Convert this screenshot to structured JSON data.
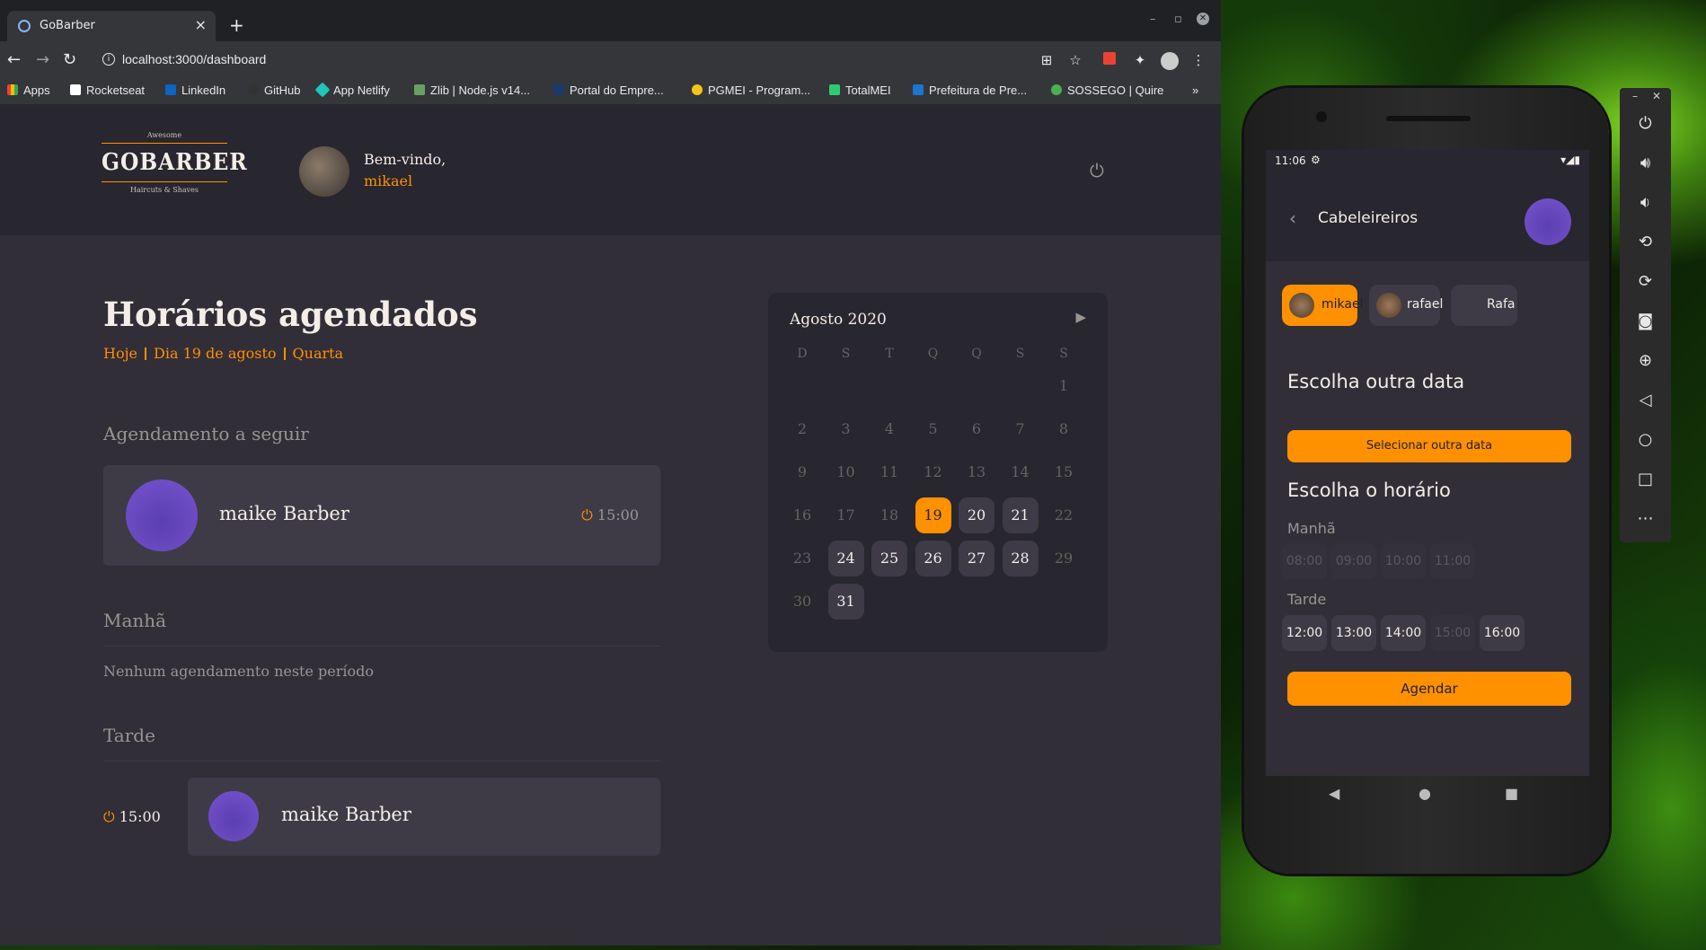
{
  "browser": {
    "tab_title": "GoBarber",
    "url": "localhost:3000/dashboard",
    "bookmarks": [
      "Apps",
      "Rocketseat",
      "LinkedIn",
      "GitHub",
      "App Netlify",
      "Zlib | Node.js v14...",
      "Portal do Empre...",
      "PGMEI - Program...",
      "TotalMEI",
      "Prefeitura de Pre...",
      "SOSSEGO | Quire"
    ],
    "bookmarks_more": "»"
  },
  "app": {
    "logo": {
      "top": "Awesome",
      "name": "GOBARBER",
      "sub": "Haircuts & Shaves"
    },
    "welcome": "Bem-vindo,",
    "username": "mikael",
    "title": "Horários agendados",
    "today": "Hoje",
    "day": "Dia 19 de agosto",
    "weekday": "Quarta",
    "next_label": "Agendamento a seguir",
    "next": {
      "name": "maike Barber",
      "time": "15:00"
    },
    "morning_label": "Manhã",
    "morning_empty": "Nenhum agendamento neste período",
    "afternoon_label": "Tarde",
    "afternoon": [
      {
        "time": "15:00",
        "name": "maike Barber"
      }
    ]
  },
  "calendar": {
    "title": "Agosto 2020",
    "weekdays": [
      "D",
      "S",
      "T",
      "Q",
      "Q",
      "S",
      "S"
    ],
    "days": [
      1,
      2,
      3,
      4,
      5,
      6,
      7,
      8,
      9,
      10,
      11,
      12,
      13,
      14,
      15,
      16,
      17,
      18,
      19,
      20,
      21,
      22,
      23,
      24,
      25,
      26,
      27,
      28,
      29,
      30,
      31
    ],
    "first_weekday": 6,
    "selected": 19,
    "available": [
      20,
      21,
      24,
      25,
      26,
      27,
      28,
      31
    ]
  },
  "phone": {
    "time": "11:06",
    "title": "Cabeleireiros",
    "providers": [
      "mikael",
      "rafael",
      "Rafa"
    ],
    "selected_provider": "mikael",
    "choose_date": "Escolha outra data",
    "select_date_btn": "Selecionar outra data",
    "choose_hour": "Escolha o horário",
    "morning": "Manhã",
    "morning_hours": [
      {
        "h": "08:00",
        "available": false
      },
      {
        "h": "09:00",
        "available": false
      },
      {
        "h": "10:00",
        "available": false
      },
      {
        "h": "11:00",
        "available": false
      }
    ],
    "afternoon": "Tarde",
    "afternoon_hours": [
      {
        "h": "12:00",
        "available": true
      },
      {
        "h": "13:00",
        "available": true
      },
      {
        "h": "14:00",
        "available": true
      },
      {
        "h": "15:00",
        "available": false
      },
      {
        "h": "16:00",
        "available": true
      }
    ],
    "schedule_btn": "Agendar"
  },
  "colors": {
    "accent": "#ff9000",
    "bg": "#312e38",
    "card": "#3e3b47",
    "header": "#28262e"
  }
}
